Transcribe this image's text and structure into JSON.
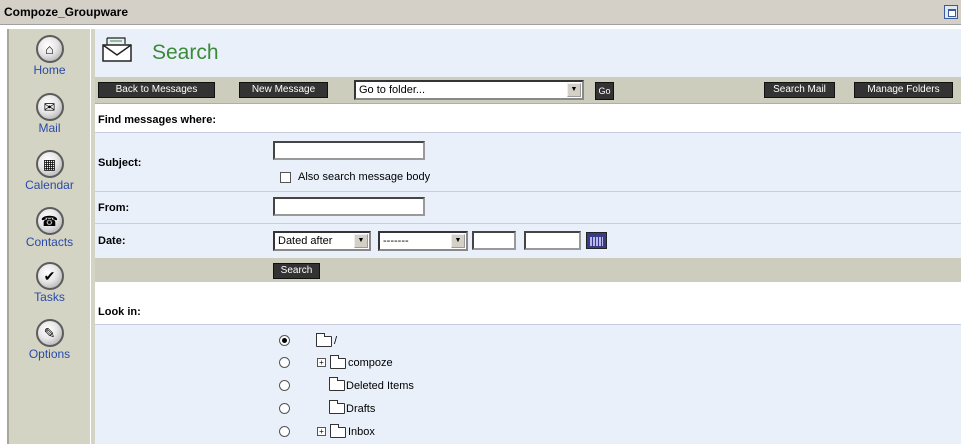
{
  "window": {
    "title": "Compoze_Groupware"
  },
  "sidebar": {
    "items": [
      {
        "label": "Home",
        "icon": "home-icon",
        "glyph": "⌂"
      },
      {
        "label": "Mail",
        "icon": "mail-icon",
        "glyph": "✉"
      },
      {
        "label": "Calendar",
        "icon": "calendar-icon",
        "glyph": "▦"
      },
      {
        "label": "Contacts",
        "icon": "contacts-icon",
        "glyph": "☎"
      },
      {
        "label": "Tasks",
        "icon": "tasks-icon",
        "glyph": "✔"
      },
      {
        "label": "Options",
        "icon": "options-icon",
        "glyph": "✎"
      }
    ]
  },
  "header": {
    "title": "Search",
    "icon": "mail-envelope-icon",
    "title_color": "#3a8a3a"
  },
  "toolbar": {
    "back_label": "Back to Messages",
    "new_label": "New Message",
    "folder_select_value": "Go to folder...",
    "go_label": "Go",
    "search_mail_label": "Search Mail",
    "manage_folders_label": "Manage Folders"
  },
  "find": {
    "heading": "Find messages where:",
    "subject_label": "Subject:",
    "subject_value": "",
    "body_checkbox_label": "Also search message body",
    "body_checked": false,
    "from_label": "From:",
    "from_value": "",
    "date_label": "Date:",
    "date_mode_value": "Dated after",
    "date_month_value": "-------",
    "date_day_value": "",
    "date_year_value": "",
    "search_button_label": "Search"
  },
  "lookin": {
    "heading": "Look in:",
    "folders": [
      {
        "label": "/",
        "selected": true,
        "expander": false,
        "icon": "folder-icon"
      },
      {
        "label": "compoze",
        "selected": false,
        "expander": true,
        "icon": "folder-icon"
      },
      {
        "label": "Deleted Items",
        "selected": false,
        "expander": false,
        "icon": "trash-folder-icon"
      },
      {
        "label": "Drafts",
        "selected": false,
        "expander": false,
        "icon": "drafts-folder-icon"
      },
      {
        "label": "Inbox",
        "selected": false,
        "expander": true,
        "icon": "inbox-folder-icon"
      }
    ]
  },
  "colors": {
    "panel": "#eaf0fa",
    "bar": "#cdcdbd",
    "sidebar": "#d4d4c4",
    "link": "#2a4aa8",
    "button": "#333333"
  }
}
